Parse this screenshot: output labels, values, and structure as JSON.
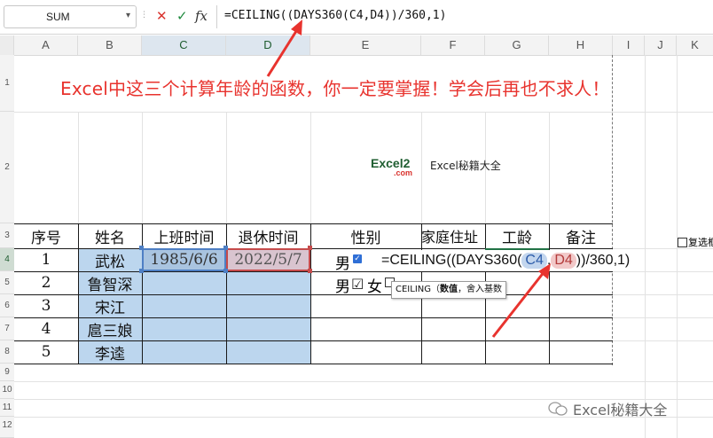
{
  "formula_bar": {
    "name_box": "SUM",
    "cancel_glyph": "✕",
    "confirm_glyph": "✓",
    "fx_label": "fx",
    "formula": "=CEILING((DAYS360(C4,D4))/360,1)"
  },
  "columns": [
    "A",
    "B",
    "C",
    "D",
    "E",
    "F",
    "G",
    "H",
    "I",
    "J",
    "K"
  ],
  "rows": [
    "1",
    "2",
    "3",
    "4",
    "5",
    "6",
    "7",
    "8",
    "9",
    "10",
    "11",
    "12"
  ],
  "banner": "Excel中这三个计算年龄的函数，你一定要掌握！学会后再也不求人！",
  "logo": {
    "main": "Excel2",
    "sub": ".com",
    "caption": "Excel秘籍大全"
  },
  "table": {
    "headers": [
      "序号",
      "姓名",
      "上班时间",
      "退休时间",
      "性别",
      "家庭住址",
      "工龄",
      "备注"
    ],
    "rows": [
      {
        "no": "1",
        "name": "武松",
        "start": "1985/6/6",
        "end": "2022/5/7"
      },
      {
        "no": "2",
        "name": "鲁智深"
      },
      {
        "no": "3",
        "name": "宋江"
      },
      {
        "no": "4",
        "name": "扈三娘"
      },
      {
        "no": "5",
        "name": "李逵"
      }
    ]
  },
  "gender": {
    "row4": "男",
    "row5_male": "男",
    "row5_female": "女"
  },
  "edit": {
    "prefix": "=CEILING((DAYS360(",
    "ref1": "C4",
    "comma": ",",
    "ref2": "D4",
    "suffix": "))/360,1)"
  },
  "tooltip": {
    "func": "CEILING（",
    "arg": "数值",
    "rest": "，舍入基数"
  },
  "checkbox_label": "复选框",
  "watermark": "Excel秘籍大全",
  "colors": {
    "accent_red": "#e8332e",
    "selection_blue": "#bcd6ee",
    "green": "#217346"
  }
}
